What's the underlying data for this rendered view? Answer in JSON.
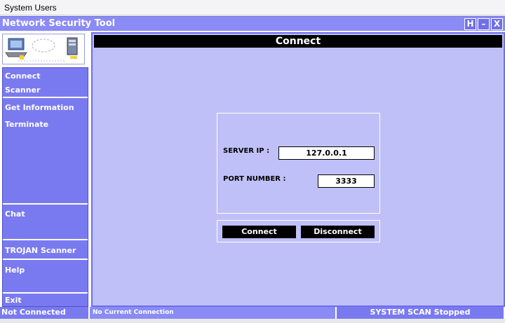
{
  "window": {
    "os_title": "System Users",
    "app_title": "Network Security Tool",
    "buttons": {
      "help": "H",
      "minimize": "–",
      "close": "X"
    }
  },
  "sidebar": {
    "items": [
      {
        "label": "Connect"
      },
      {
        "label": "Scanner"
      },
      {
        "label": "Get Information"
      },
      {
        "label": "Terminate"
      },
      {
        "label": "Chat"
      },
      {
        "label": "TROJAN Scanner"
      },
      {
        "label": "Help"
      },
      {
        "label": "Exit"
      }
    ]
  },
  "main": {
    "title": "Connect",
    "server_ip": {
      "label": "SERVER IP :",
      "value": "127.0.0.1"
    },
    "port": {
      "label": "PORT NUMBER :",
      "value": "3333"
    },
    "connect_label": "Connect",
    "disconnect_label": "Disconnect"
  },
  "status": {
    "connection": "Not Connected",
    "current": "No Current Connection",
    "scan": "SYSTEM SCAN Stopped"
  },
  "colors": {
    "accent": "#8b8bf5",
    "sidebar_menu": "#7a7af0",
    "main_bg": "#c0c0f8"
  }
}
